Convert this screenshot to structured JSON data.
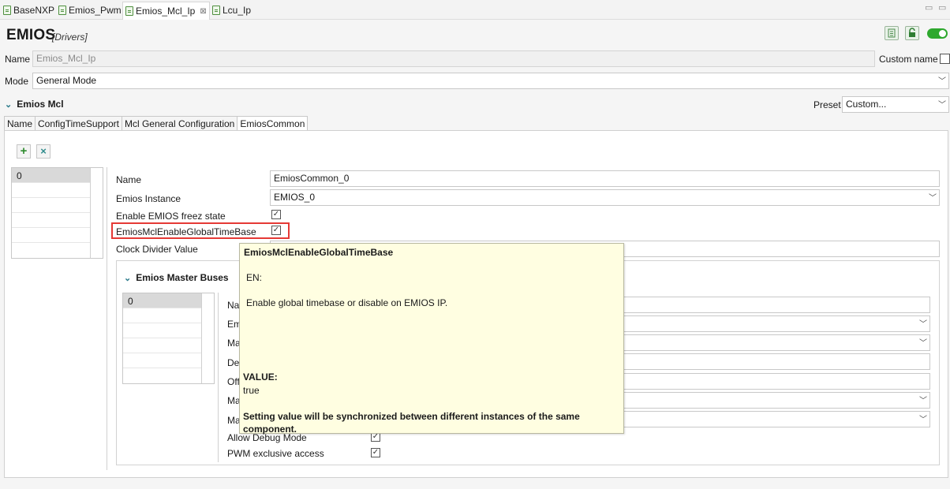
{
  "editor_tabs": [
    {
      "label": "BaseNXP"
    },
    {
      "label": "Emios_Pwm"
    },
    {
      "label": "Emios_Mcl_Ip",
      "close": "⊠"
    },
    {
      "label": "Lcu_Ip"
    }
  ],
  "window_controls": {
    "minimize": "▭",
    "maximize": "▭"
  },
  "header": {
    "title": "EMIOS",
    "subtitle": "[Drivers]"
  },
  "name_row": {
    "label": "Name",
    "value": "Emios_Mcl_Ip",
    "custom_name_label": "Custom name"
  },
  "mode_row": {
    "label": "Mode",
    "value": "General Mode"
  },
  "section": {
    "title": "Emios Mcl",
    "preset_label": "Preset",
    "preset_value": "Custom..."
  },
  "config_tabs": [
    "Name",
    "ConfigTimeSupport",
    "Mcl General Configuration",
    "EmiosCommon"
  ],
  "instance_list": [
    "0"
  ],
  "form": {
    "name_label": "Name",
    "name_value": "EmiosCommon_0",
    "instance_label": "Emios Instance",
    "instance_value": "EMIOS_0",
    "freeze_label": "Enable EMIOS freez state",
    "freeze_check": "✓",
    "global_tb_label": "EmiosMclEnableGlobalTimeBase",
    "global_tb_check": "✓",
    "clock_div_label": "Clock Divider Value"
  },
  "master_buses": {
    "title": "Emios Master Buses",
    "list": [
      "0"
    ],
    "labels": [
      "Na",
      "Em",
      "Ma",
      "De",
      "Off",
      "Ma",
      "Ma"
    ],
    "allow_debug_label": "Allow Debug Mode",
    "allow_debug_check": "✓",
    "pwm_excl_label": "PWM exclusive access",
    "pwm_excl_check": "✓"
  },
  "tooltip": {
    "title": "EmiosMclEnableGlobalTimeBase",
    "en": "EN:",
    "description": "Enable global timebase or disable on EMIOS IP.",
    "value_label": "VALUE:",
    "value": "true",
    "sync_note": "Setting value will be synchronized between different instances of the same component."
  },
  "colors": {
    "toggle": "#2ea82e",
    "highlight": "#e53935",
    "tooltip_bg": "#fffee1"
  }
}
